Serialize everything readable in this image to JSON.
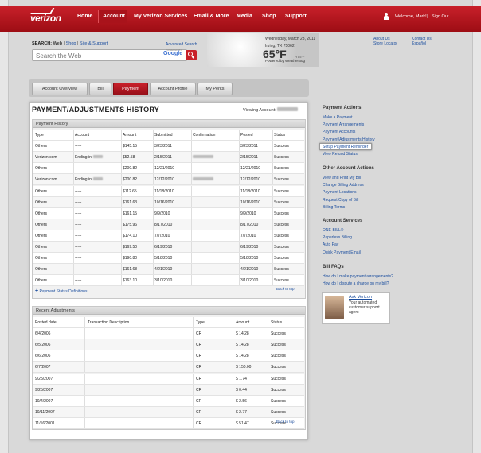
{
  "nav": {
    "brand": "verizon",
    "items": [
      "Home",
      "Account",
      "My Verizon Services",
      "Email & More",
      "Media",
      "Shop",
      "Support"
    ],
    "active": "Account",
    "welcome": "Welcome, Mark!",
    "signout": "Sign Out"
  },
  "search": {
    "label": "SEARCH:",
    "web": "Web",
    "shop": "Shop",
    "site": "Site & Support",
    "advanced": "Advanced Search",
    "placeholder": "Search the Web",
    "powered_small": "POWERED BY",
    "powered": "Google"
  },
  "weather": {
    "date": "Wednesday, March 23, 2011",
    "location": "Irving, TX 75062",
    "temp": "65°F",
    "hilo": "H 85°F",
    "by": "Powered by WeatherBug"
  },
  "toplinks": {
    "col1": [
      "About Us",
      "Store Locator"
    ],
    "col2": [
      "Contact Us",
      "Español"
    ]
  },
  "tabs": [
    "Account Overview",
    "Bill",
    "Payment",
    "Account Profile",
    "My Perks"
  ],
  "active_tab": "Payment",
  "page": {
    "title": "PAYMENT/ADJUSTMENTS HISTORY",
    "viewing": "Viewing Account:"
  },
  "payment_history": {
    "heading": "Payment History",
    "columns": [
      "Type",
      "Account",
      "Amount",
      "Submitted",
      "Confirmation",
      "Posted",
      "Status"
    ],
    "rows": [
      [
        "Others",
        "-----",
        "$145.15",
        "3/23/2011",
        "",
        "3/23/2011",
        "Success"
      ],
      [
        "Verizon.com",
        "Ending in",
        "$52.58",
        "2/15/2011",
        "",
        "2/15/2011",
        "Success"
      ],
      [
        "Others",
        "-----",
        "$200.82",
        "12/21/2010",
        "",
        "12/21/2010",
        "Success"
      ],
      [
        "Verizon.com",
        "Ending in",
        "$200.82",
        "12/12/2010",
        "",
        "12/12/2010",
        "Success"
      ],
      [
        "Others",
        "-----",
        "$112.65",
        "11/18/2010",
        "",
        "11/18/2010",
        "Success"
      ],
      [
        "Others",
        "-----",
        "$161.63",
        "10/16/2010",
        "",
        "10/16/2010",
        "Success"
      ],
      [
        "Others",
        "-----",
        "$161.15",
        "9/9/2010",
        "",
        "9/9/2010",
        "Success"
      ],
      [
        "Others",
        "-----",
        "$175.96",
        "8/17/2010",
        "",
        "8/17/2010",
        "Success"
      ],
      [
        "Others",
        "-----",
        "$174.10",
        "7/7/2010",
        "",
        "7/7/2010",
        "Success"
      ],
      [
        "Others",
        "-----",
        "$169.50",
        "6/19/2010",
        "",
        "6/19/2010",
        "Success"
      ],
      [
        "Others",
        "-----",
        "$190.80",
        "5/18/2010",
        "",
        "5/18/2010",
        "Success"
      ],
      [
        "Others",
        "-----",
        "$161.68",
        "4/21/2010",
        "",
        "4/21/2010",
        "Success"
      ],
      [
        "Others",
        "-----",
        "$163.10",
        "3/10/2010",
        "",
        "3/10/2010",
        "Success"
      ]
    ],
    "definitions": "Payment Status Definitions",
    "back": "Back to top"
  },
  "adjustments": {
    "heading": "Recent Adjustments",
    "columns": [
      "Posted date",
      "Transaction Description",
      "Type",
      "Amount",
      "Status"
    ],
    "rows": [
      [
        "6/4/2006",
        "",
        "CR",
        "$ 14.28",
        "Success"
      ],
      [
        "6/5/2006",
        "",
        "CR",
        "$ 14.28",
        "Success"
      ],
      [
        "6/6/2006",
        "",
        "CR",
        "$ 14.28",
        "Success"
      ],
      [
        "6/7/2007",
        "",
        "CR",
        "$ 150.00",
        "Success"
      ],
      [
        "9/25/2007",
        "",
        "CR",
        "$ 1.74",
        "Success"
      ],
      [
        "9/25/2007",
        "",
        "CR",
        "$ 0.44",
        "Success"
      ],
      [
        "10/4/2007",
        "",
        "CR",
        "$ 2.56",
        "Success"
      ],
      [
        "10/11/2007",
        "",
        "CR",
        "$ 2.77",
        "Success"
      ],
      [
        "11/16/2001",
        "",
        "CR",
        "$ 51.47",
        "Success"
      ]
    ],
    "back": "Back to top"
  },
  "sidebar": {
    "sections": [
      {
        "title": "Payment Actions",
        "links": [
          "Make a Payment",
          "Payment Arrangements",
          "Payment Accounts",
          "Payment/Adjustments History",
          "Setup Payment Reminder",
          "View Refund Status"
        ]
      },
      {
        "title": "Other Account Actions",
        "links": [
          "View and Print My Bill",
          "Change Billing Address",
          "Payment Locations",
          "Request Copy of Bill",
          "Billing Terms"
        ]
      },
      {
        "title": "Account Services",
        "links": [
          "ONE-BILL®",
          "Paperless Billing",
          "Auto Pay",
          "Quick Payment Email"
        ]
      },
      {
        "title": "Bill FAQs",
        "links": [
          "How do I make payment arrangements?",
          "How do I dispute a charge on my bill?"
        ]
      }
    ],
    "ask_title": "Ask Verizon",
    "ask_text": "Your automated customer support agent"
  }
}
